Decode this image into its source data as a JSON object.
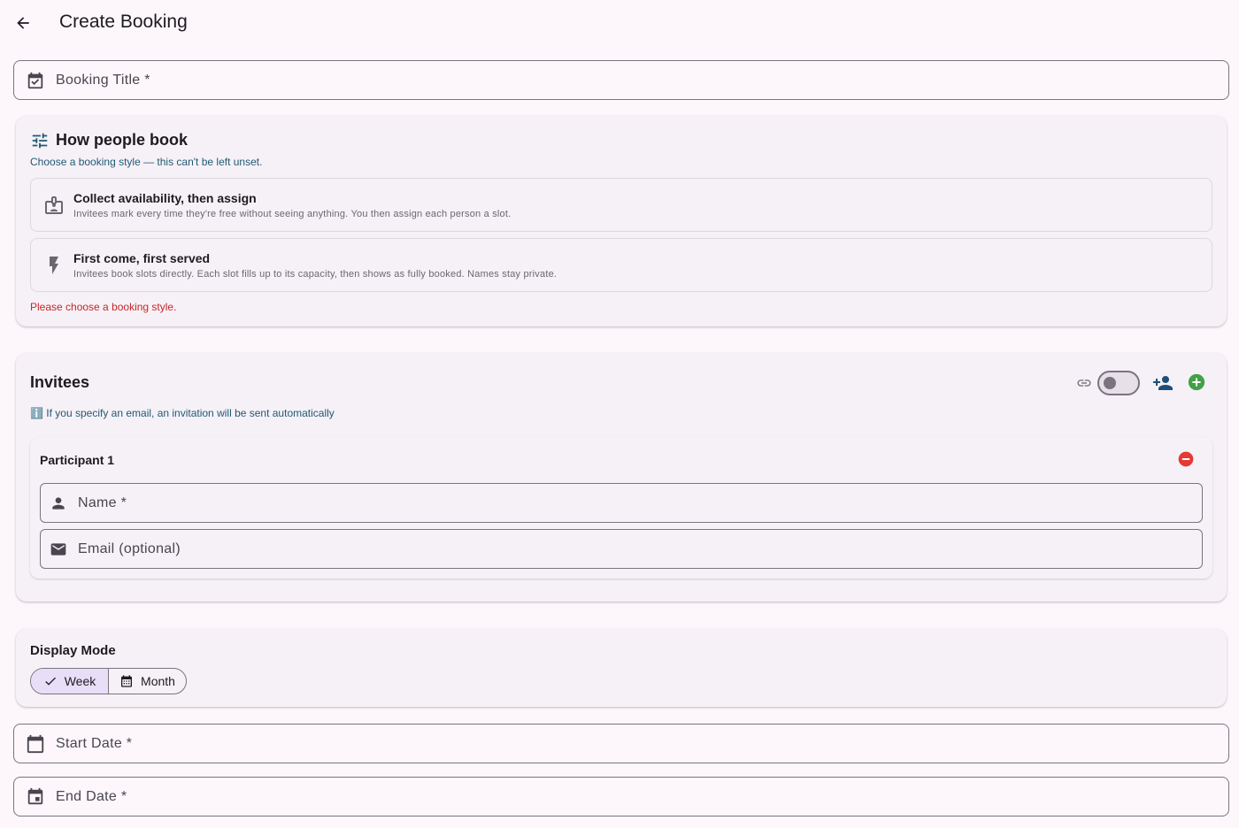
{
  "header": {
    "title": "Create Booking"
  },
  "booking_title": {
    "label": "Booking Title *"
  },
  "booking_style": {
    "title": "How people book",
    "hint": "Choose a booking style — this can't be left unset.",
    "options": [
      {
        "title": "Collect availability, then assign",
        "description": "Invitees mark every time they're free without seeing anything. You then assign each person a slot."
      },
      {
        "title": "First come, first served",
        "description": "Invitees book slots directly. Each slot fills up to its capacity, then shows as fully booked. Names stay private."
      }
    ],
    "error": "Please choose a booking style."
  },
  "invitees": {
    "title": "Invitees",
    "info_icon": "ℹ️",
    "hint": "If you specify an email, an invitation will be sent automatically",
    "link_toggle_on": false,
    "participants": [
      {
        "title": "Participant 1",
        "name_label": "Name *",
        "email_label": "Email (optional)"
      }
    ]
  },
  "display_mode": {
    "title": "Display Mode",
    "options": [
      {
        "label": "Week",
        "selected": true
      },
      {
        "label": "Month",
        "selected": false
      }
    ]
  },
  "dates": {
    "start_label": "Start Date *",
    "end_label": "End Date *"
  },
  "colors": {
    "accent": "#1f5a73",
    "error": "#c62828",
    "add_green": "#43a047",
    "remove_red": "#e53935",
    "selected_segment": "#e8def8",
    "background": "#fdf7fc"
  }
}
